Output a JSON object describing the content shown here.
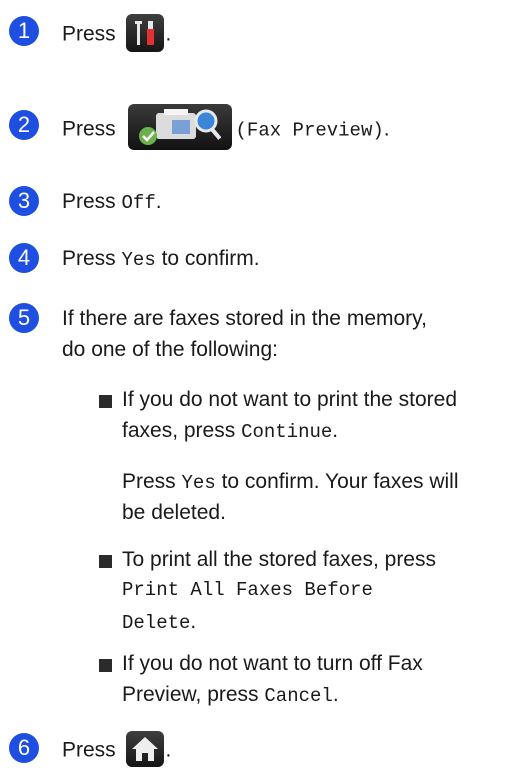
{
  "steps": [
    {
      "num": "1",
      "pre": "Press",
      "post": "."
    },
    {
      "num": "2",
      "pre": "Press",
      "mono": "(Fax Preview)",
      "post": "."
    },
    {
      "num": "3",
      "pre": "Press ",
      "mono": "Off",
      "post": "."
    },
    {
      "num": "4",
      "pre": "Press ",
      "mono": "Yes",
      "post": " to confirm."
    },
    {
      "num": "5",
      "line1": "If there are faxes stored in the memory,",
      "line2": "do one of the following:"
    },
    {
      "num": "6",
      "pre": "Press",
      "post": "."
    }
  ],
  "bullets": [
    {
      "line1": "If you do not want to print the stored",
      "line2_pre": "faxes, press ",
      "line2_mono": "Continue",
      "line2_post": ".",
      "para_pre": "Press ",
      "para_mono": "Yes",
      "para_post": " to confirm. Your faxes will",
      "para_line2": "be deleted."
    },
    {
      "line1": "To print all the stored faxes, press",
      "line2_mono": "Print All Faxes Before",
      "line3_mono": "Delete",
      "line3_post": "."
    },
    {
      "line1": "If you do not want to turn off Fax",
      "line2_pre": "Preview, press ",
      "line2_mono": "Cancel",
      "line2_post": "."
    }
  ],
  "icons": {
    "settings": "settings-tools-icon",
    "fax_preview": "fax-preview-icon",
    "home": "home-icon"
  },
  "colors": {
    "step_circle": "#1f4fe0",
    "icon_bg": "#1a1a1a"
  }
}
